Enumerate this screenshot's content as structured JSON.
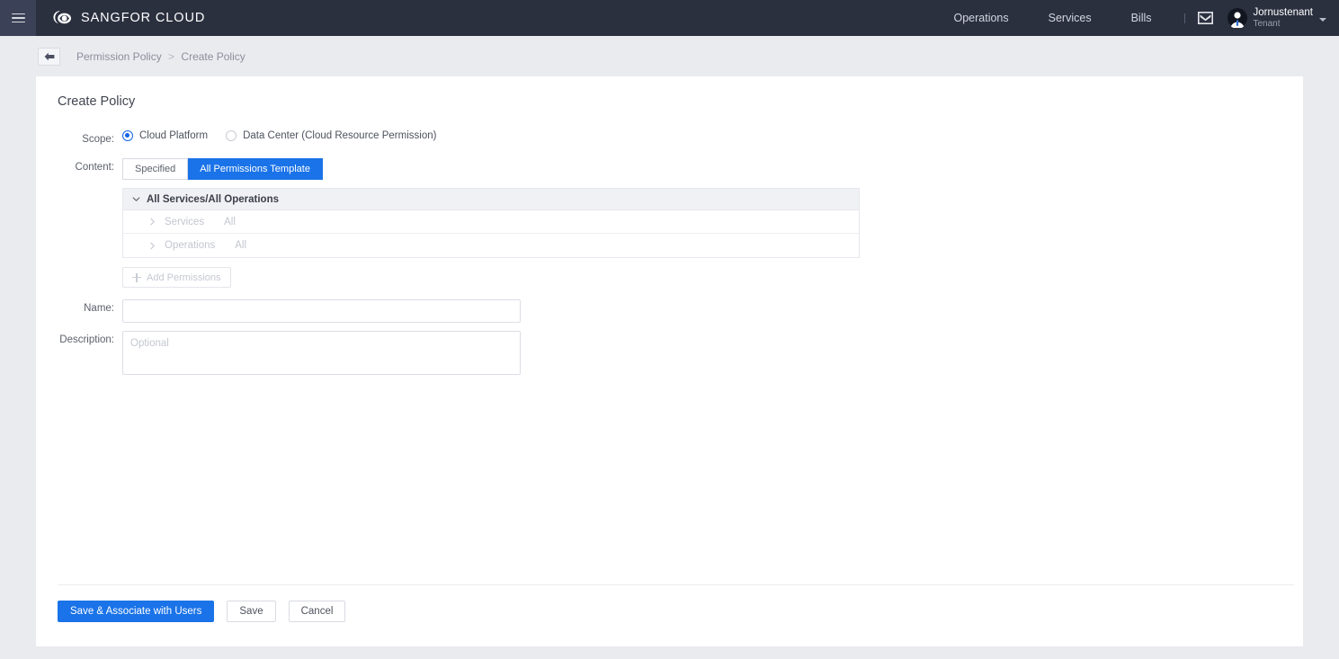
{
  "header": {
    "menu_icon": "hamburger-icon",
    "brand": "SANGFOR CLOUD",
    "brand_logo_icon": "cloud-logo-icon",
    "nav": [
      {
        "label": "Operations",
        "name": "operations"
      },
      {
        "label": "Services",
        "name": "services"
      },
      {
        "label": "Bills",
        "name": "bills"
      }
    ],
    "mail_icon": "mail-icon",
    "user": {
      "avatar_icon": "user-avatar-icon",
      "name": "Jornustenant",
      "role": "Tenant",
      "caret_icon": "chevron-down-icon"
    }
  },
  "breadcrumb": {
    "back_icon": "arrow-left-icon",
    "parent": "Permission Policy",
    "separator": ">",
    "current": "Create Policy"
  },
  "page": {
    "title": "Create Policy"
  },
  "form": {
    "scope": {
      "label": "Scope:",
      "options": [
        {
          "label": "Cloud Platform",
          "selected": true
        },
        {
          "label": "Data Center (Cloud Resource Permission)",
          "selected": false
        }
      ]
    },
    "content": {
      "label": "Content:",
      "tabs": [
        {
          "label": "Specified",
          "active": false
        },
        {
          "label": "All Permissions Template",
          "active": true
        }
      ]
    },
    "permission_tree": {
      "header": "All Services/All Operations",
      "header_icon": "chevron-down-icon",
      "rows": [
        {
          "icon": "chevron-right-icon",
          "key": "Services",
          "value": "All"
        },
        {
          "icon": "chevron-right-icon",
          "key": "Operations",
          "value": "All"
        }
      ],
      "add_button": {
        "label": "Add Permissions",
        "icon": "plus-icon",
        "disabled": true
      }
    },
    "name": {
      "label": "Name:",
      "value": "",
      "placeholder": ""
    },
    "description": {
      "label": "Description:",
      "value": "",
      "placeholder": "Optional"
    }
  },
  "footer": {
    "buttons": [
      {
        "label": "Save & Associate with Users",
        "style": "primary"
      },
      {
        "label": "Save",
        "style": "default"
      },
      {
        "label": "Cancel",
        "style": "default"
      }
    ]
  },
  "colors": {
    "header_bg": "#2b303f",
    "menu_bg": "#3b4156",
    "page_bg": "#eaebef",
    "accent": "#1a73e8",
    "radio_accent": "#1464e8",
    "card_bg": "#ffffff",
    "tree_head_bg": "#f0f1f5",
    "disabled_text": "#c3c6cf"
  }
}
